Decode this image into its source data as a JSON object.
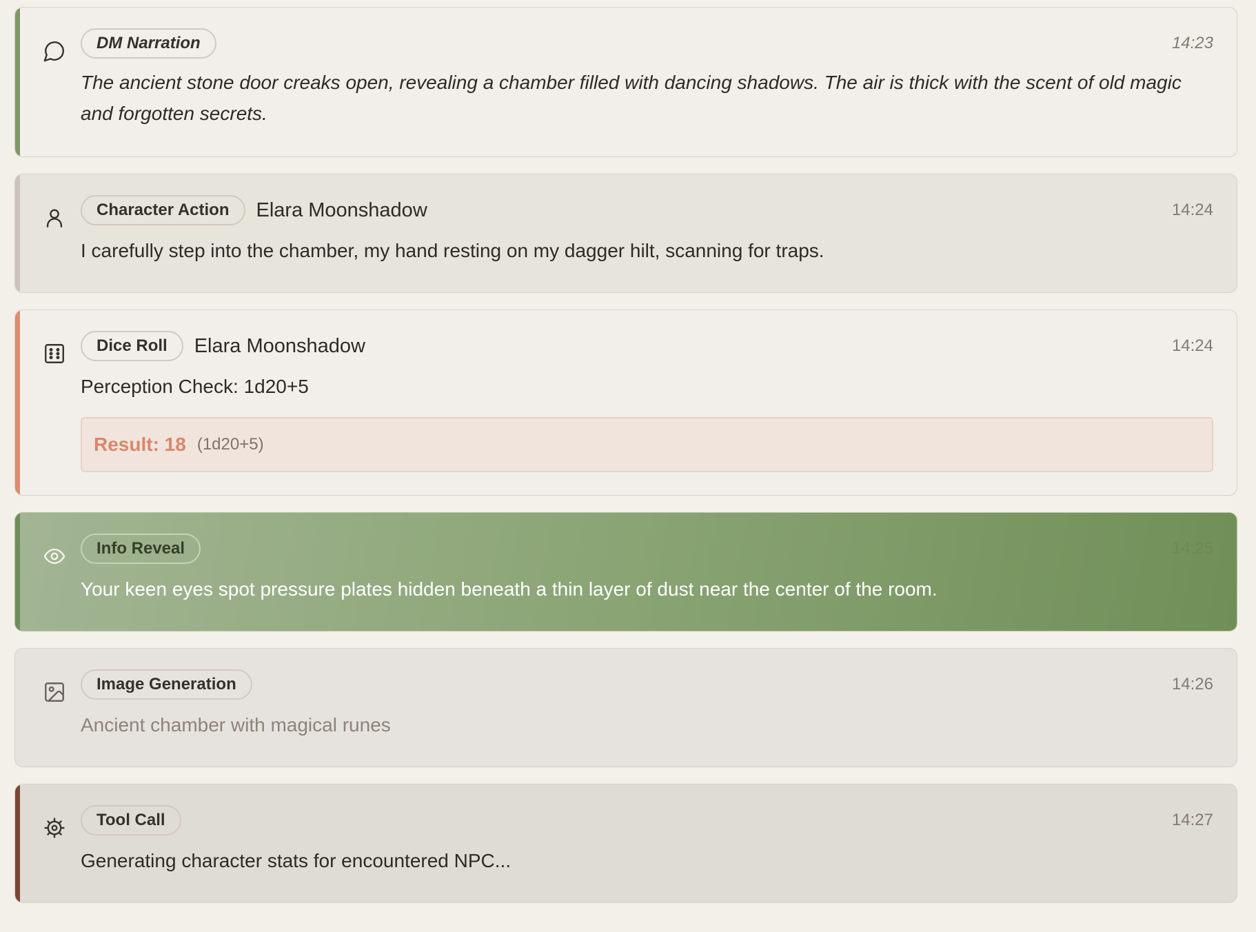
{
  "messages": [
    {
      "type": "narration",
      "badge": "DM Narration",
      "time": "14:23",
      "icon": "speech-bubble-icon",
      "text": "The ancient stone door creaks open, revealing a chamber filled with dancing shadows. The air is thick with the scent of old magic and forgotten secrets."
    },
    {
      "type": "action",
      "badge": "Character Action",
      "speaker": "Elara Moonshadow",
      "time": "14:24",
      "icon": "user-icon",
      "text": "I carefully step into the chamber, my hand resting on my dagger hilt, scanning for traps."
    },
    {
      "type": "dice",
      "badge": "Dice Roll",
      "speaker": "Elara Moonshadow",
      "time": "14:24",
      "icon": "dice-icon",
      "text": "Perception Check: 1d20+5",
      "result_label": "Result: 18",
      "result_formula": "(1d20+5)"
    },
    {
      "type": "info",
      "badge": "Info Reveal",
      "time": "14:25",
      "icon": "eye-icon",
      "text": "Your keen eyes spot pressure plates hidden beneath a thin layer of dust near the center of the room."
    },
    {
      "type": "image",
      "badge": "Image Generation",
      "time": "14:26",
      "icon": "image-icon",
      "text": "Ancient chamber with magical runes"
    },
    {
      "type": "tool",
      "badge": "Tool Call",
      "time": "14:27",
      "icon": "gear-icon",
      "text": "Generating character stats for encountered NPC..."
    }
  ],
  "colors": {
    "narration_accent": "#7d9866",
    "action_accent": "#cbc3b9",
    "dice_accent": "#dc8c6f",
    "info_gradient_start": "#a3b594",
    "info_gradient_end": "#708f58",
    "tool_accent": "#7a4533",
    "result_text": "#d9876b"
  }
}
